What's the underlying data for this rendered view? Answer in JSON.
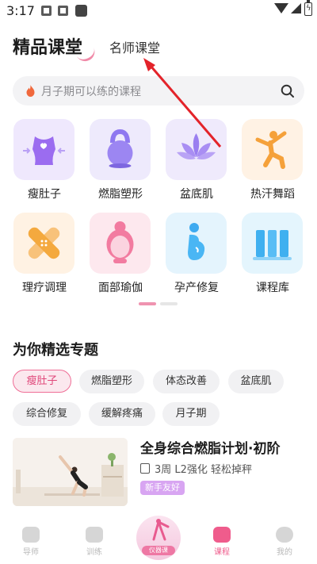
{
  "status_bar": {
    "time": "3:17"
  },
  "tabs": {
    "primary": "精品课堂",
    "secondary": "名师课堂"
  },
  "search": {
    "placeholder": "月子期可以练的课程"
  },
  "categories": [
    {
      "label": "瘦肚子",
      "icon": "waist-icon"
    },
    {
      "label": "燃脂塑形",
      "icon": "kettlebell-icon"
    },
    {
      "label": "盆底肌",
      "icon": "lotus-icon"
    },
    {
      "label": "热汗舞蹈",
      "icon": "dancer-icon"
    },
    {
      "label": "理疗调理",
      "icon": "bandage-icon"
    },
    {
      "label": "面部瑜伽",
      "icon": "face-icon"
    },
    {
      "label": "孕产修复",
      "icon": "pregnant-icon"
    },
    {
      "label": "课程库",
      "icon": "library-icon"
    }
  ],
  "pager": {
    "total_pages": 2,
    "current_page": 1
  },
  "featured": {
    "title": "为你精选专题",
    "chips": [
      "瘦肚子",
      "燃脂塑形",
      "体态改善",
      "盆底肌",
      "综合修复",
      "缓解疼痛",
      "月子期"
    ],
    "active_chip": "瘦肚子"
  },
  "course": {
    "title": "全身综合燃脂计划·初阶",
    "meta": "3周 L2强化 轻松掉秤",
    "badge": "新手友好"
  },
  "bottom_nav": {
    "items": [
      {
        "label": "导师",
        "icon": "chat-icon",
        "active": false
      },
      {
        "label": "训练",
        "icon": "dumbbell-icon",
        "active": false
      },
      {
        "label": "仪器课",
        "icon": "device-icon",
        "active": false
      },
      {
        "label": "课程",
        "icon": "video-icon",
        "active": true
      },
      {
        "label": "我的",
        "icon": "profile-icon",
        "active": false
      }
    ]
  },
  "colors": {
    "accent": "#ef5c8c",
    "annotation_arrow": "#e3232a",
    "badge": "#d8a5f2"
  }
}
